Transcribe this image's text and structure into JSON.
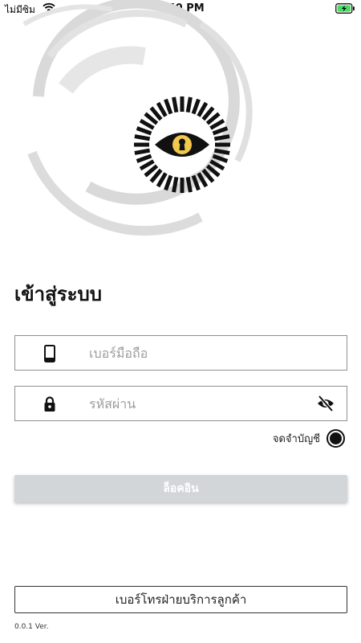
{
  "status_bar": {
    "carrier": "ไม่มีซิม",
    "time": "4:40 PM",
    "icons": [
      "wifi-icon",
      "battery-charging-icon"
    ]
  },
  "logo": {
    "icon": "eye-keyhole-logo"
  },
  "login": {
    "title": "เข้าสู่ระบบ",
    "phone_placeholder": "เบอร์มือถือ",
    "phone_value": "",
    "phone_icon": "smartphone-icon",
    "password_placeholder": "รหัสผ่าน",
    "password_value": "",
    "password_icon": "lock-icon",
    "toggle_visibility_icon": "eye-off-icon",
    "remember_label": "จดจำบัญชี",
    "remember_checked": true,
    "submit_label": "ล็อคอิน"
  },
  "footer": {
    "hotline_label": "เบอร์โทรฝ่ายบริการลูกค้า",
    "version": "0.0.1 Ver."
  },
  "colors": {
    "accent": "#111111",
    "disabled_button": "#d3d6d9",
    "battery_green": "#4cd964",
    "keyhole_gold": "#f2c94c"
  }
}
